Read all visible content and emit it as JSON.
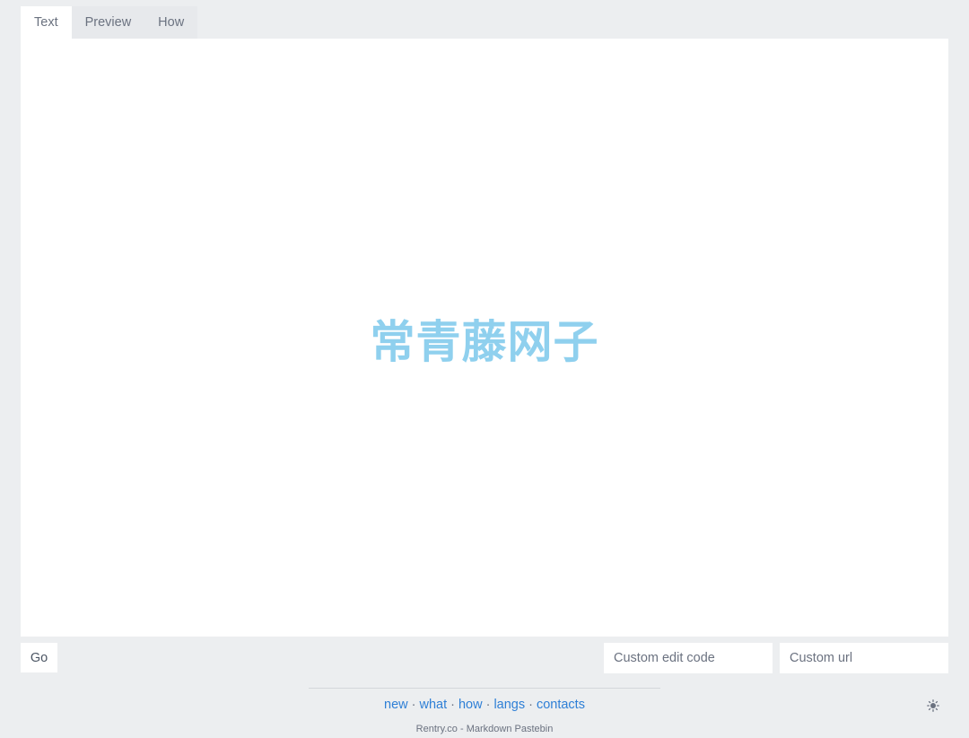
{
  "tabs": [
    {
      "label": "Text",
      "active": true
    },
    {
      "label": "Preview",
      "active": false
    },
    {
      "label": "How",
      "active": false
    }
  ],
  "editor": {
    "value": "",
    "watermark": "常青藤网子"
  },
  "actions": {
    "go_label": "Go",
    "edit_code_placeholder": "Custom edit code",
    "custom_url_placeholder": "Custom url"
  },
  "footer": {
    "links": [
      "new",
      "what",
      "how",
      "langs",
      "contacts"
    ],
    "separator": "·",
    "tagline": "Rentry.co - Markdown Pastebin"
  },
  "icons": {
    "theme_toggle": "sun-icon"
  },
  "colors": {
    "background": "#eceef0",
    "link": "#2e7fd6",
    "watermark": "#8fd0ee"
  }
}
